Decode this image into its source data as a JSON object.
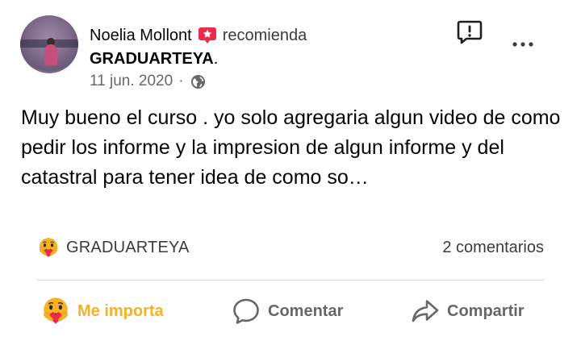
{
  "post": {
    "author": {
      "name": "Noelia Mollont",
      "action_text": "recomienda",
      "page_name": "GRADUARTEYA",
      "page_suffix": ".",
      "avatar_icon": "avatar-photo"
    },
    "meta": {
      "date": "11 jun. 2020",
      "separator": "·",
      "audience_icon": "globe-icon"
    },
    "header_icons": {
      "recommend_icon": "recommend-badge-icon",
      "report_icon": "report-icon",
      "more_icon": "more-options-icon"
    },
    "body_text": "Muy bueno el curso . yo solo agregaria algun video de como pedir los informe y la impresion de algun informe y del catastral para tener idea de como so…",
    "stats": {
      "reaction_icon": "care-reaction-icon",
      "reactor": "GRADUARTEYA",
      "comments": "2 comentarios"
    },
    "actions": {
      "like_label": "Me importa",
      "like_icon": "care-reaction-icon",
      "comment_label": "Comentar",
      "comment_icon": "comment-bubble-icon",
      "share_label": "Compartir",
      "share_icon": "share-arrow-icon"
    }
  },
  "colors": {
    "recommend_red": "#f02849",
    "care_yellow": "#f7b125",
    "text_primary": "#050505",
    "text_secondary": "#65676b",
    "divider": "#d7d9dc"
  }
}
